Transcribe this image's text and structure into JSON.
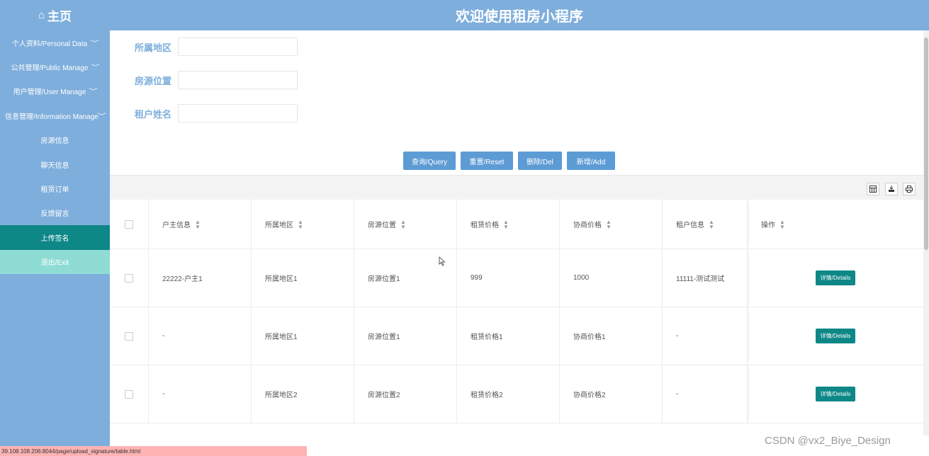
{
  "sidebar": {
    "brand_icon": "⌂",
    "brand": "主页",
    "items": [
      {
        "label": "个人资料/Personal Data",
        "expandable": true
      },
      {
        "label": "公共管理/Public Manage",
        "expandable": true
      },
      {
        "label": "用户管理/User Manage",
        "expandable": true
      },
      {
        "label": "信息管理/Information Manage",
        "expandable": true
      }
    ],
    "sub_items": [
      {
        "label": "房源信息"
      },
      {
        "label": "聊天信息"
      },
      {
        "label": "租赁订单"
      },
      {
        "label": "反馈留言"
      },
      {
        "label": "上传签名",
        "active": true
      }
    ],
    "exit": "退出/Exit"
  },
  "header": {
    "title": "欢迎使用租房小程序"
  },
  "search": {
    "region_label": "所属地区",
    "location_label": "房源位置",
    "tenant_label": "租户姓名"
  },
  "actions": {
    "query": "查询/Query",
    "reset": "重置/Reset",
    "delete": "删除/Del",
    "add": "新增/Add"
  },
  "toolbar": {
    "icons": [
      "columns-icon",
      "export-icon",
      "print-icon"
    ]
  },
  "table": {
    "columns": [
      "户主信息",
      "所属地区",
      "房源位置",
      "租赁价格",
      "协商价格",
      "租户信息",
      "操作"
    ],
    "detail_label": "详情/Details",
    "rows": [
      [
        "22222-户主1",
        "所属地区1",
        "房源位置1",
        "999",
        "1000",
        "11111-测试测试"
      ],
      [
        "-",
        "所属地区1",
        "房源位置1",
        "租赁价格1",
        "协商价格1",
        "-"
      ],
      [
        "-",
        "所属地区2",
        "房源位置2",
        "租赁价格2",
        "协商价格2",
        "-"
      ]
    ]
  },
  "status_url": "39.108.108.206:8044/page/upload_signature/table.html",
  "watermark": "CSDN @vx2_Biye_Design",
  "colors": {
    "primary": "#7eaedc",
    "accent": "#0e8787",
    "button": "#5d9bd5",
    "exit": "#8fdcd4"
  }
}
